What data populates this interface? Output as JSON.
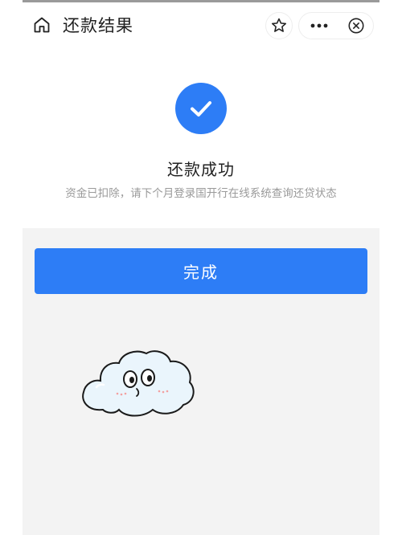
{
  "header": {
    "title": "还款结果",
    "home_icon": "home-icon",
    "star_icon": "star-icon",
    "more_icon": "more-dots-icon",
    "close_icon": "close-circle-icon"
  },
  "result": {
    "status_icon": "check-icon",
    "title": "还款成功",
    "description": "资金已扣除，请下个月登录国开行在线系统查询还贷状态"
  },
  "actions": {
    "done_label": "完成"
  },
  "colors": {
    "accent": "#2d7df6",
    "page_background": "#f3f3f3",
    "title_text": "#222222",
    "muted_text": "#9a9a9a"
  },
  "sticker": "cloud-sticker"
}
